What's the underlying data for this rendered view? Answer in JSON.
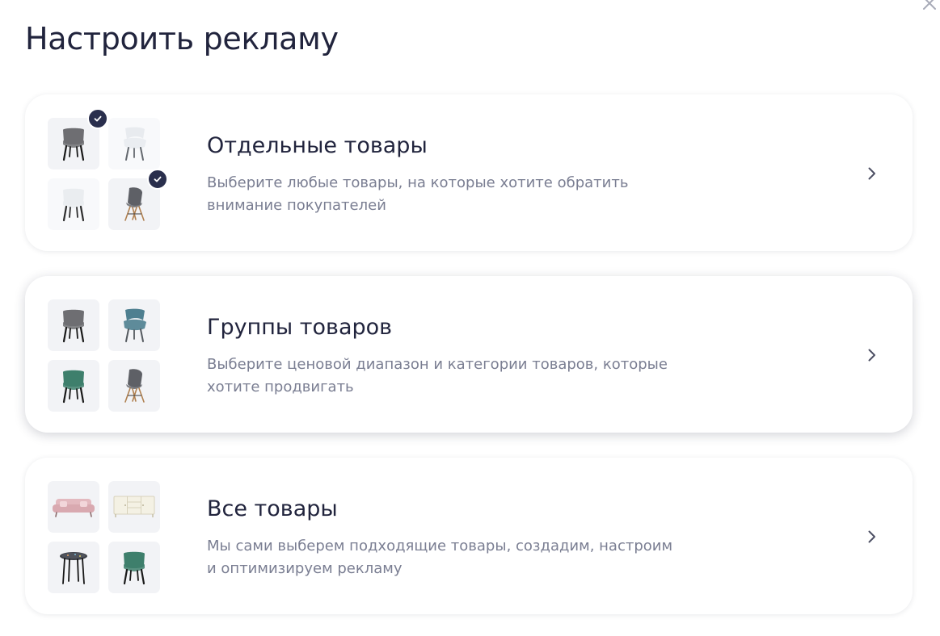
{
  "header": {
    "title": "Настроить рекламу"
  },
  "options": [
    {
      "title": "Отдельные товары",
      "description_line1": "Выберите любые товары, на которые хотите обратить",
      "description_line2": "внимание покупателей",
      "thumbnails": [
        "gray-armchair-chair",
        "white-shell-chair",
        "white-armchair-chair",
        "gray-eames-chair"
      ],
      "checked_thumbnails": [
        "gray-armchair-chair",
        "gray-eames-chair"
      ]
    },
    {
      "title": "Группы товаров",
      "description_line1": "Выберите ценовой диапазон и категории товаров, которые",
      "description_line2": "хотите продвигать",
      "thumbnails": [
        "gray-armchair-chair",
        "blue-shell-chair",
        "green-armchair-chair",
        "gray-eames-chair"
      ]
    },
    {
      "title": "Все товары",
      "description_line1": "Мы сами выберем подходящие товары, создадим, настроим",
      "description_line2": "и оптимизируем рекламу",
      "thumbnails": [
        "pink-sofa",
        "white-sideboard",
        "round-table",
        "green-armchair-chair"
      ]
    }
  ],
  "colors": {
    "title": "#21243d",
    "description": "#7a7e92",
    "thumbnail_bg": "#f2f3f6",
    "check_badge": "#2a2f4d"
  },
  "icons": {
    "close": "close-icon",
    "chevron": "chevron-right-icon",
    "check": "check-icon"
  }
}
